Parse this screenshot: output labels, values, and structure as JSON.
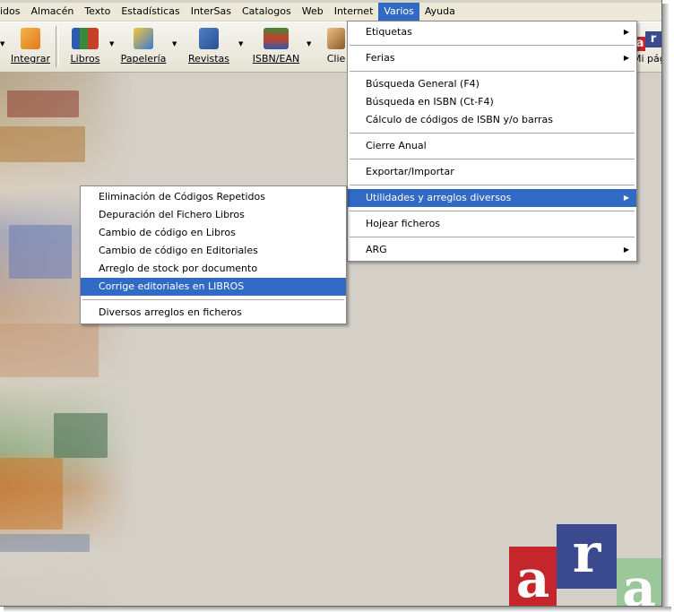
{
  "menubar": {
    "items": [
      {
        "label": "idos"
      },
      {
        "label": "Almacén"
      },
      {
        "label": "Texto"
      },
      {
        "label": "Estadísticas"
      },
      {
        "label": "InterSas"
      },
      {
        "label": "Catalogos"
      },
      {
        "label": "Web"
      },
      {
        "label": "Internet"
      },
      {
        "label": "Varios"
      },
      {
        "label": "Ayuda"
      }
    ]
  },
  "toolbar": {
    "integrar": "Integrar",
    "libros": "Libros",
    "papeleria": "Papelería",
    "revistas": "Revistas",
    "isbn": "ISBN/EAN",
    "clientes": "Clie",
    "mipagina": "Mi pág"
  },
  "varios_menu": {
    "items": [
      {
        "label": "Etiquetas",
        "submenu": true
      },
      {
        "label": "Ferias",
        "submenu": true
      },
      {
        "label": "Búsqueda General (F4)"
      },
      {
        "label": "Búsqueda en ISBN (Ct-F4)"
      },
      {
        "label": "Cálculo de códigos de ISBN y/o barras"
      },
      {
        "label": "Cierre Anual"
      },
      {
        "label": "Exportar/Importar"
      },
      {
        "label": "Utilidades y arreglos diversos",
        "submenu": true
      },
      {
        "label": "Hojear ficheros"
      },
      {
        "label": "ARG",
        "submenu": true
      }
    ]
  },
  "utilidades_menu": {
    "items": [
      {
        "label": "Eliminación de Códigos Repetidos"
      },
      {
        "label": "Depuración del Fichero Libros"
      },
      {
        "label": "Cambio de código en Libros"
      },
      {
        "label": "Cambio de código en Editoriales"
      },
      {
        "label": "Arreglo de stock por documento"
      },
      {
        "label": "Corrige editoriales en LIBROS"
      },
      {
        "label": "Diversos arreglos en ficheros"
      }
    ]
  },
  "logo": {
    "a1": "a",
    "r": "r",
    "a2": "a"
  },
  "toolbar_logo": {
    "a": "a",
    "r": "r"
  },
  "colors": {
    "selection": "#316ac5",
    "logo_red": "#c5262b",
    "logo_blue": "#3b4a8f",
    "logo_green": "#9cc79a"
  }
}
